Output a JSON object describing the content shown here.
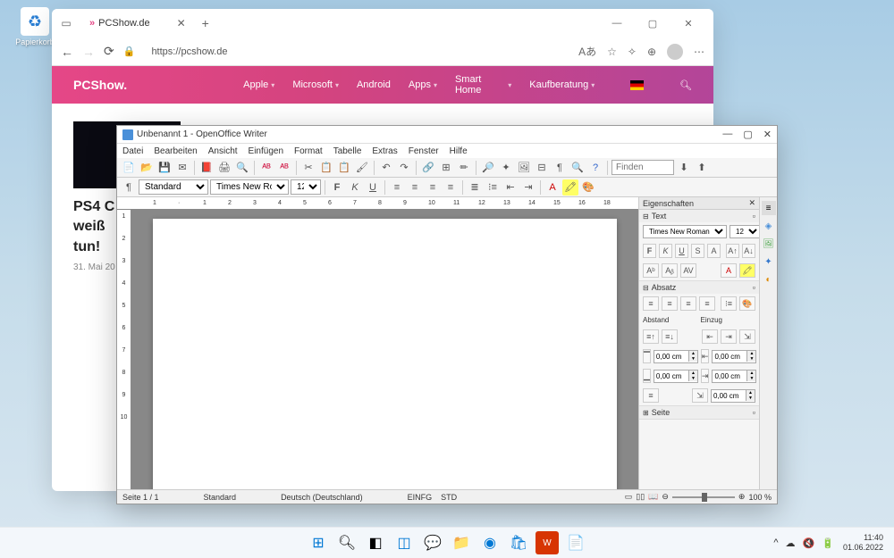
{
  "desktop": {
    "recycle_bin": "Papierkorb"
  },
  "browser": {
    "tab_title": "PCShow.de",
    "url": "https://pcshow.de",
    "site_logo": "PCShow.",
    "nav": [
      "Apple",
      "Microsoft",
      "Android",
      "Apps",
      "Smart Home",
      "Kaufberatung"
    ],
    "article": {
      "title_l1": "PS4 C",
      "title_l2": "weiß",
      "title_l3": "tun!",
      "date": "31. Mai 20"
    }
  },
  "writer": {
    "title": "Unbenannt 1 - OpenOffice Writer",
    "menu": [
      "Datei",
      "Bearbeiten",
      "Ansicht",
      "Einfügen",
      "Format",
      "Tabelle",
      "Extras",
      "Fenster",
      "Hilfe"
    ],
    "toolbar2": {
      "style": "Standard",
      "font": "Times New Roman",
      "size": "12"
    },
    "find_placeholder": "Finden",
    "props": {
      "title": "Eigenschaften",
      "text_section": "Text",
      "font": "Times New Roman",
      "size": "12",
      "paragraph_section": "Absatz",
      "spacing": "Abstand",
      "indent": "Einzug",
      "val": "0,00 cm",
      "page_section": "Seite"
    },
    "status": {
      "page": "Seite 1 / 1",
      "style": "Standard",
      "lang": "Deutsch (Deutschland)",
      "insert": "EINFG",
      "sel": "STD",
      "zoom": "100 %"
    }
  },
  "taskbar": {
    "time": "11:40",
    "date": "01.06.2022"
  }
}
